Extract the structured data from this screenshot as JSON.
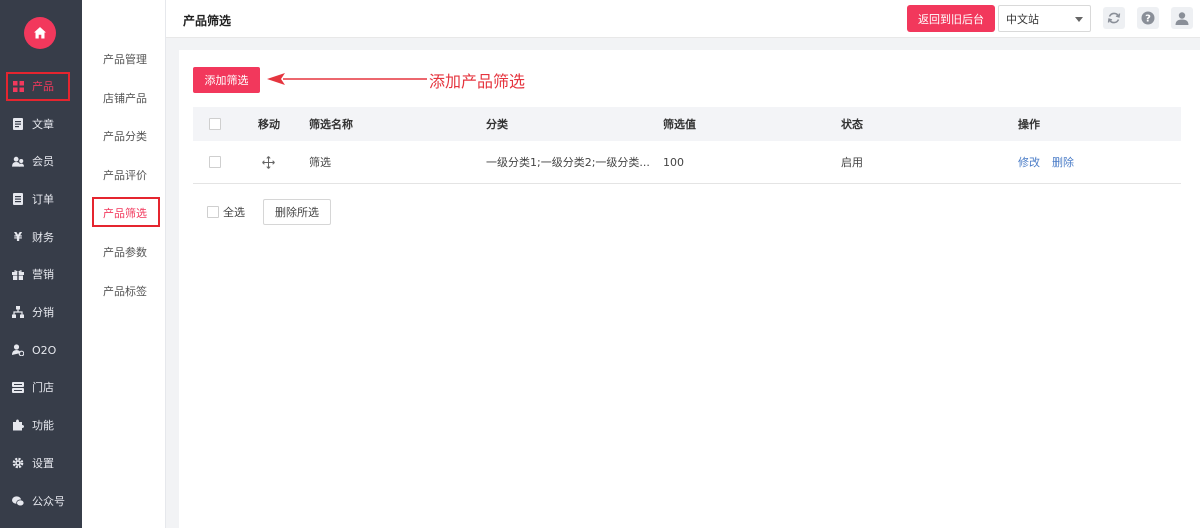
{
  "sidebar": {
    "items": [
      {
        "label": "产品",
        "icon": "grid-icon"
      },
      {
        "label": "文章",
        "icon": "document-icon"
      },
      {
        "label": "会员",
        "icon": "users-icon"
      },
      {
        "label": "订单",
        "icon": "order-icon"
      },
      {
        "label": "财务",
        "icon": "yen-icon"
      },
      {
        "label": "营销",
        "icon": "gift-icon"
      },
      {
        "label": "分销",
        "icon": "sitemap-icon"
      },
      {
        "label": "O2O",
        "icon": "o2o-icon"
      },
      {
        "label": "门店",
        "icon": "store-icon"
      },
      {
        "label": "功能",
        "icon": "puzzle-icon"
      },
      {
        "label": "设置",
        "icon": "gear-icon"
      },
      {
        "label": "公众号",
        "icon": "wechat-icon"
      }
    ]
  },
  "submenu": {
    "items": [
      {
        "label": "产品管理"
      },
      {
        "label": "店铺产品"
      },
      {
        "label": "产品分类"
      },
      {
        "label": "产品评价"
      },
      {
        "label": "产品筛选"
      },
      {
        "label": "产品参数"
      },
      {
        "label": "产品标签"
      }
    ]
  },
  "header": {
    "title": "产品筛选",
    "back_button": "返回到旧后台",
    "language": "中文站"
  },
  "main": {
    "add_button": "添加筛选",
    "annotation": "添加产品筛选",
    "table": {
      "columns": [
        "移动",
        "筛选名称",
        "分类",
        "筛选值",
        "状态",
        "操作"
      ],
      "rows": [
        {
          "name": "筛选",
          "category": "一级分类1;一级分类2;一级分类...",
          "value": "100",
          "status": "启用",
          "edit": "修改",
          "delete": "删除"
        }
      ]
    },
    "select_all": "全选",
    "delete_selected": "删除所选"
  },
  "colors": {
    "accent": "#f2385c",
    "sidebar_bg": "#373d49",
    "highlight_frame": "#e5252f",
    "link": "#4a7cc7"
  }
}
